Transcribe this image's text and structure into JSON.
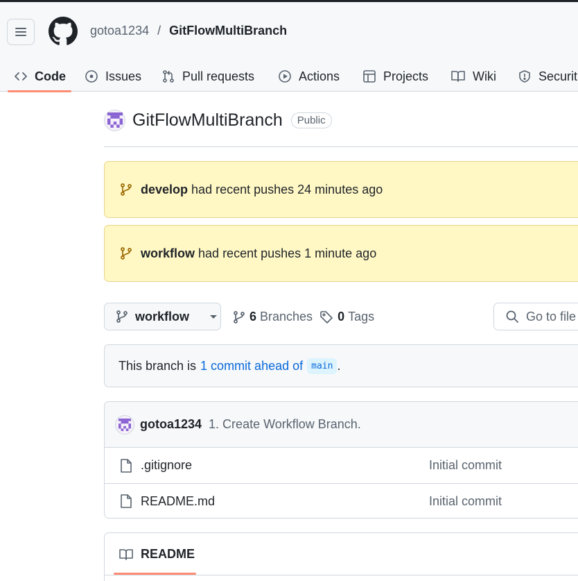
{
  "header": {
    "owner": "gotoa1234",
    "separator": "/",
    "repo": "GitFlowMultiBranch",
    "icons": {
      "menu": "hamburger-icon",
      "logo": "github-mark-icon"
    }
  },
  "tabs": [
    {
      "label": "Code",
      "icon": "code-icon",
      "active": true
    },
    {
      "label": "Issues",
      "icon": "issue-opened-icon"
    },
    {
      "label": "Pull requests",
      "icon": "git-pull-request-icon"
    },
    {
      "label": "Actions",
      "icon": "play-icon"
    },
    {
      "label": "Projects",
      "icon": "table-icon"
    },
    {
      "label": "Wiki",
      "icon": "book-icon"
    },
    {
      "label": "Securit",
      "icon": "shield-icon"
    }
  ],
  "repo": {
    "title": "GitFlowMultiBranch",
    "visibility": "Public"
  },
  "recent_pushes": [
    {
      "branch": "develop",
      "text": "had recent pushes 24 minutes ago"
    },
    {
      "branch": "workflow",
      "text": "had recent pushes 1 minute ago"
    }
  ],
  "toolbar": {
    "branch": "workflow",
    "branches_count": "6",
    "branches_label": "Branches",
    "tags_count": "0",
    "tags_label": "Tags",
    "goto_placeholder": "Go to file"
  },
  "ahead_banner": {
    "prefix": "This branch is",
    "link": "1 commit ahead of",
    "base": "main",
    "suffix": "."
  },
  "latest_commit": {
    "author": "gotoa1234",
    "message": "1. Create Workflow Branch."
  },
  "files": [
    {
      "name": ".gitignore",
      "message": "Initial commit"
    },
    {
      "name": "README.md",
      "message": "Initial commit"
    }
  ],
  "readme": {
    "label": "README"
  },
  "colors": {
    "accent_underline": "#fd8c73",
    "flash_bg": "#fff8c5",
    "link": "#0969da",
    "avatar": "#8a63d2"
  }
}
